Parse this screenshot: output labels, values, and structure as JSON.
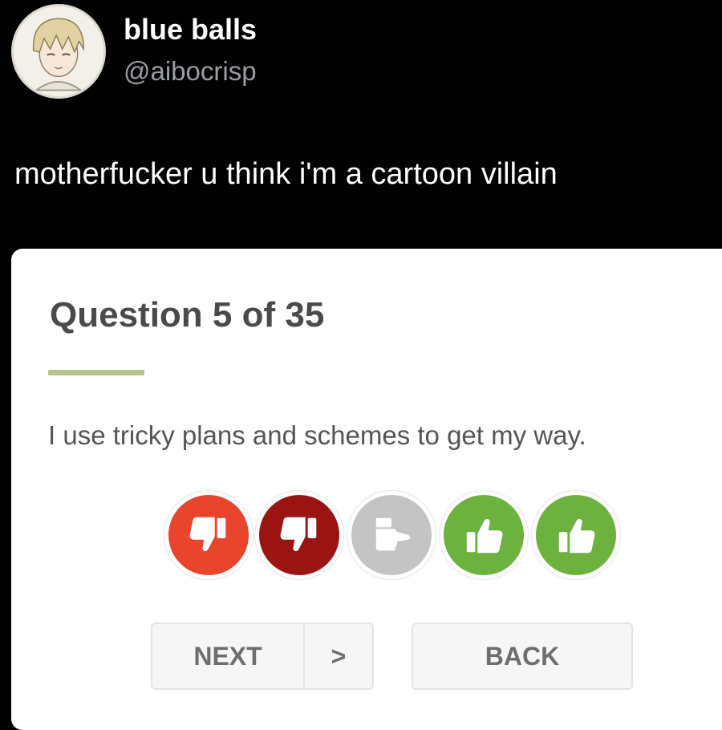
{
  "tweet": {
    "display_name": "blue balls",
    "handle": "@aibocrisp",
    "text": "motherfucker u think i'm a cartoon villain",
    "avatar_icon": "anime-character-avatar"
  },
  "quiz": {
    "title": "Question 5 of 35",
    "question": "I use tricky plans and schemes to get my way.",
    "options": [
      {
        "name": "strongly-disagree",
        "icon": "thumbs-down-icon",
        "color": "#e8452c"
      },
      {
        "name": "disagree",
        "icon": "thumbs-down-icon",
        "color": "#9b1414"
      },
      {
        "name": "neutral",
        "icon": "sideways-thumb-icon",
        "color": "#c4c4c4"
      },
      {
        "name": "agree",
        "icon": "thumbs-up-icon",
        "color": "#6db23e"
      },
      {
        "name": "strongly-agree",
        "icon": "thumbs-up-icon",
        "color": "#6db23e"
      }
    ],
    "next_label": "NEXT",
    "next_chevron": ">",
    "back_label": "BACK",
    "accent_color": "#b5c488"
  }
}
